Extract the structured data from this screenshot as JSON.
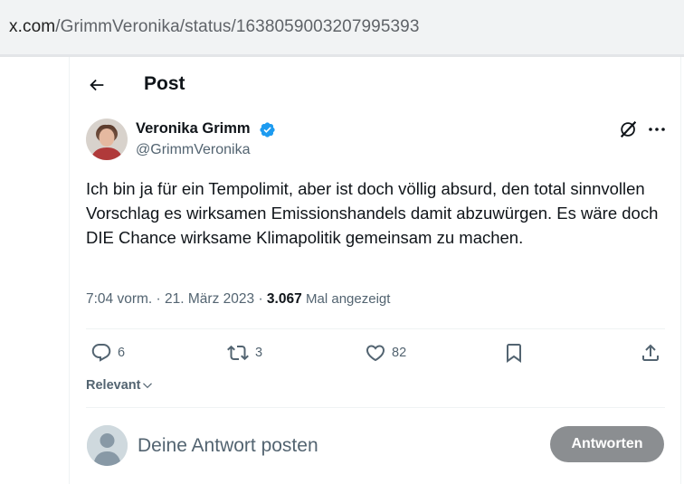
{
  "address_bar": {
    "host": "x.com",
    "path": "/GrimmVeronika/status/1638059003207995393"
  },
  "header": {
    "back_icon": "arrow-left-icon",
    "title": "Post"
  },
  "tweet": {
    "author_name": "Veronika Grimm",
    "author_handle": "@GrimmVeronika",
    "verified": true,
    "verified_color": "#1d9bf0",
    "text": "Ich bin ja für ein Tempolimit, aber ist doch völlig absurd, den total sinnvollen Vorschlag es wirksamen Emissionshandels damit abzuwürgen. Es wäre doch DIE Chance wirksame Klimapolitik gemeinsam zu machen.",
    "time": "7:04 vorm.",
    "separator": "·",
    "date": "21. März 2023",
    "views_count": "3.067",
    "views_label": "Mal angezeigt"
  },
  "actions": {
    "replies": "6",
    "reposts": "3",
    "likes": "82"
  },
  "sort": {
    "label": "Relevant"
  },
  "reply_box": {
    "placeholder": "Deine Antwort posten",
    "button_label": "Antworten",
    "button_color": "#8b8e91"
  },
  "colors": {
    "text_primary": "#0f1419",
    "text_secondary": "#536471",
    "border": "#eff3f4"
  }
}
